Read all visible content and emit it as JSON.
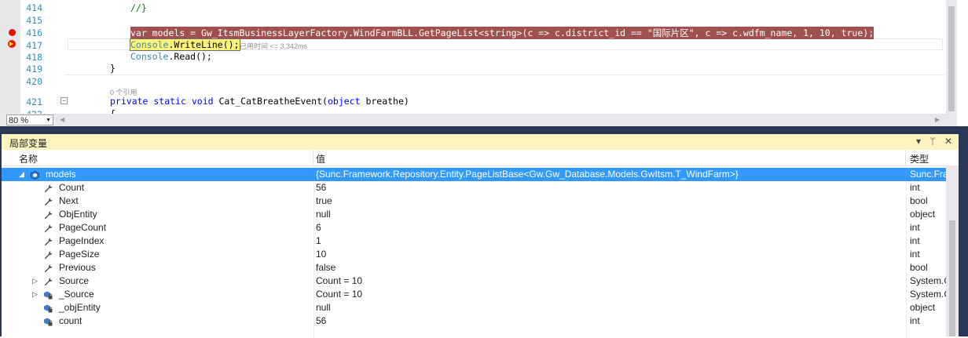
{
  "editor": {
    "lines": [
      {
        "num": "414",
        "text": "//}"
      },
      {
        "num": "415",
        "text": ""
      },
      {
        "num": "416",
        "text_kw": "var",
        "text_a": " models = Gw_ItsmBusinessLayerFactory.WindFarmBLL.GetPageList<",
        "text_ty": "string",
        "text_b": ">(c => c.district_id == ",
        "text_str": "\"国际片区\"",
        "text_c": ", c => c.wdfm_name, 1, 10, ",
        "text_kw2": "true",
        "text_d": ");"
      },
      {
        "num": "417",
        "text_ty": "Console",
        "text_a": ".",
        "text_b": "WriteLine",
        "text_c": "();"
      },
      {
        "num": "418",
        "text_ty": "Console",
        "text_a": ".Read();"
      },
      {
        "num": "419",
        "text": "}"
      },
      {
        "num": "420",
        "text": ""
      },
      {
        "num": "421",
        "text_kw": "private static void",
        "text_a": " Cat_CatBreatheEvent(",
        "text_kw2": "object",
        "text_b": " breathe)"
      },
      {
        "num": "422",
        "text": "{"
      }
    ],
    "elapsed_hint": "已用时间 <= 3,342ms",
    "refs_hint": "0 个引用",
    "zoom": "80 %"
  },
  "panel": {
    "title": "局部变量",
    "buttons": [
      "▾",
      "ᛘ",
      "✕"
    ],
    "headers": {
      "name": "名称",
      "value": "值",
      "type": "类型"
    },
    "rows": [
      {
        "name": "models",
        "value": "{Sunc.Framework.Repository.Entity.PageListBase<Gw.Gw_Database.Models.GwItsm.T_WindFarm>}",
        "type": "Sunc.Fra",
        "icon": "object-icon",
        "expander": "◢",
        "top": true,
        "selected": true
      },
      {
        "name": "Count",
        "value": "56",
        "type": "int",
        "icon": "wrench-icon"
      },
      {
        "name": "Next",
        "value": "true",
        "type": "bool",
        "icon": "wrench-icon"
      },
      {
        "name": "ObjEntity",
        "value": "null",
        "type": "object",
        "icon": "wrench-icon"
      },
      {
        "name": "PageCount",
        "value": "6",
        "type": "int",
        "icon": "wrench-icon"
      },
      {
        "name": "PageIndex",
        "value": "1",
        "type": "int",
        "icon": "wrench-icon"
      },
      {
        "name": "PageSize",
        "value": "10",
        "type": "int",
        "icon": "wrench-icon"
      },
      {
        "name": "Previous",
        "value": "false",
        "type": "bool",
        "icon": "wrench-icon"
      },
      {
        "name": "Source",
        "value": "Count = 10",
        "type": "System.C",
        "icon": "wrench-icon",
        "expander": "▷"
      },
      {
        "name": "_Source",
        "value": "Count = 10",
        "type": "System.C",
        "icon": "private-field-icon",
        "expander": "▷"
      },
      {
        "name": "_objEntity",
        "value": "null",
        "type": "object",
        "icon": "private-field-icon"
      },
      {
        "name": "count",
        "value": "56",
        "type": "int",
        "icon": "private-field-icon"
      }
    ]
  },
  "colors": {
    "highlight_line": "#a0504f",
    "selection": "#3399ff",
    "frame": "#293955",
    "panel_title_bg": "#fdf4bf"
  }
}
